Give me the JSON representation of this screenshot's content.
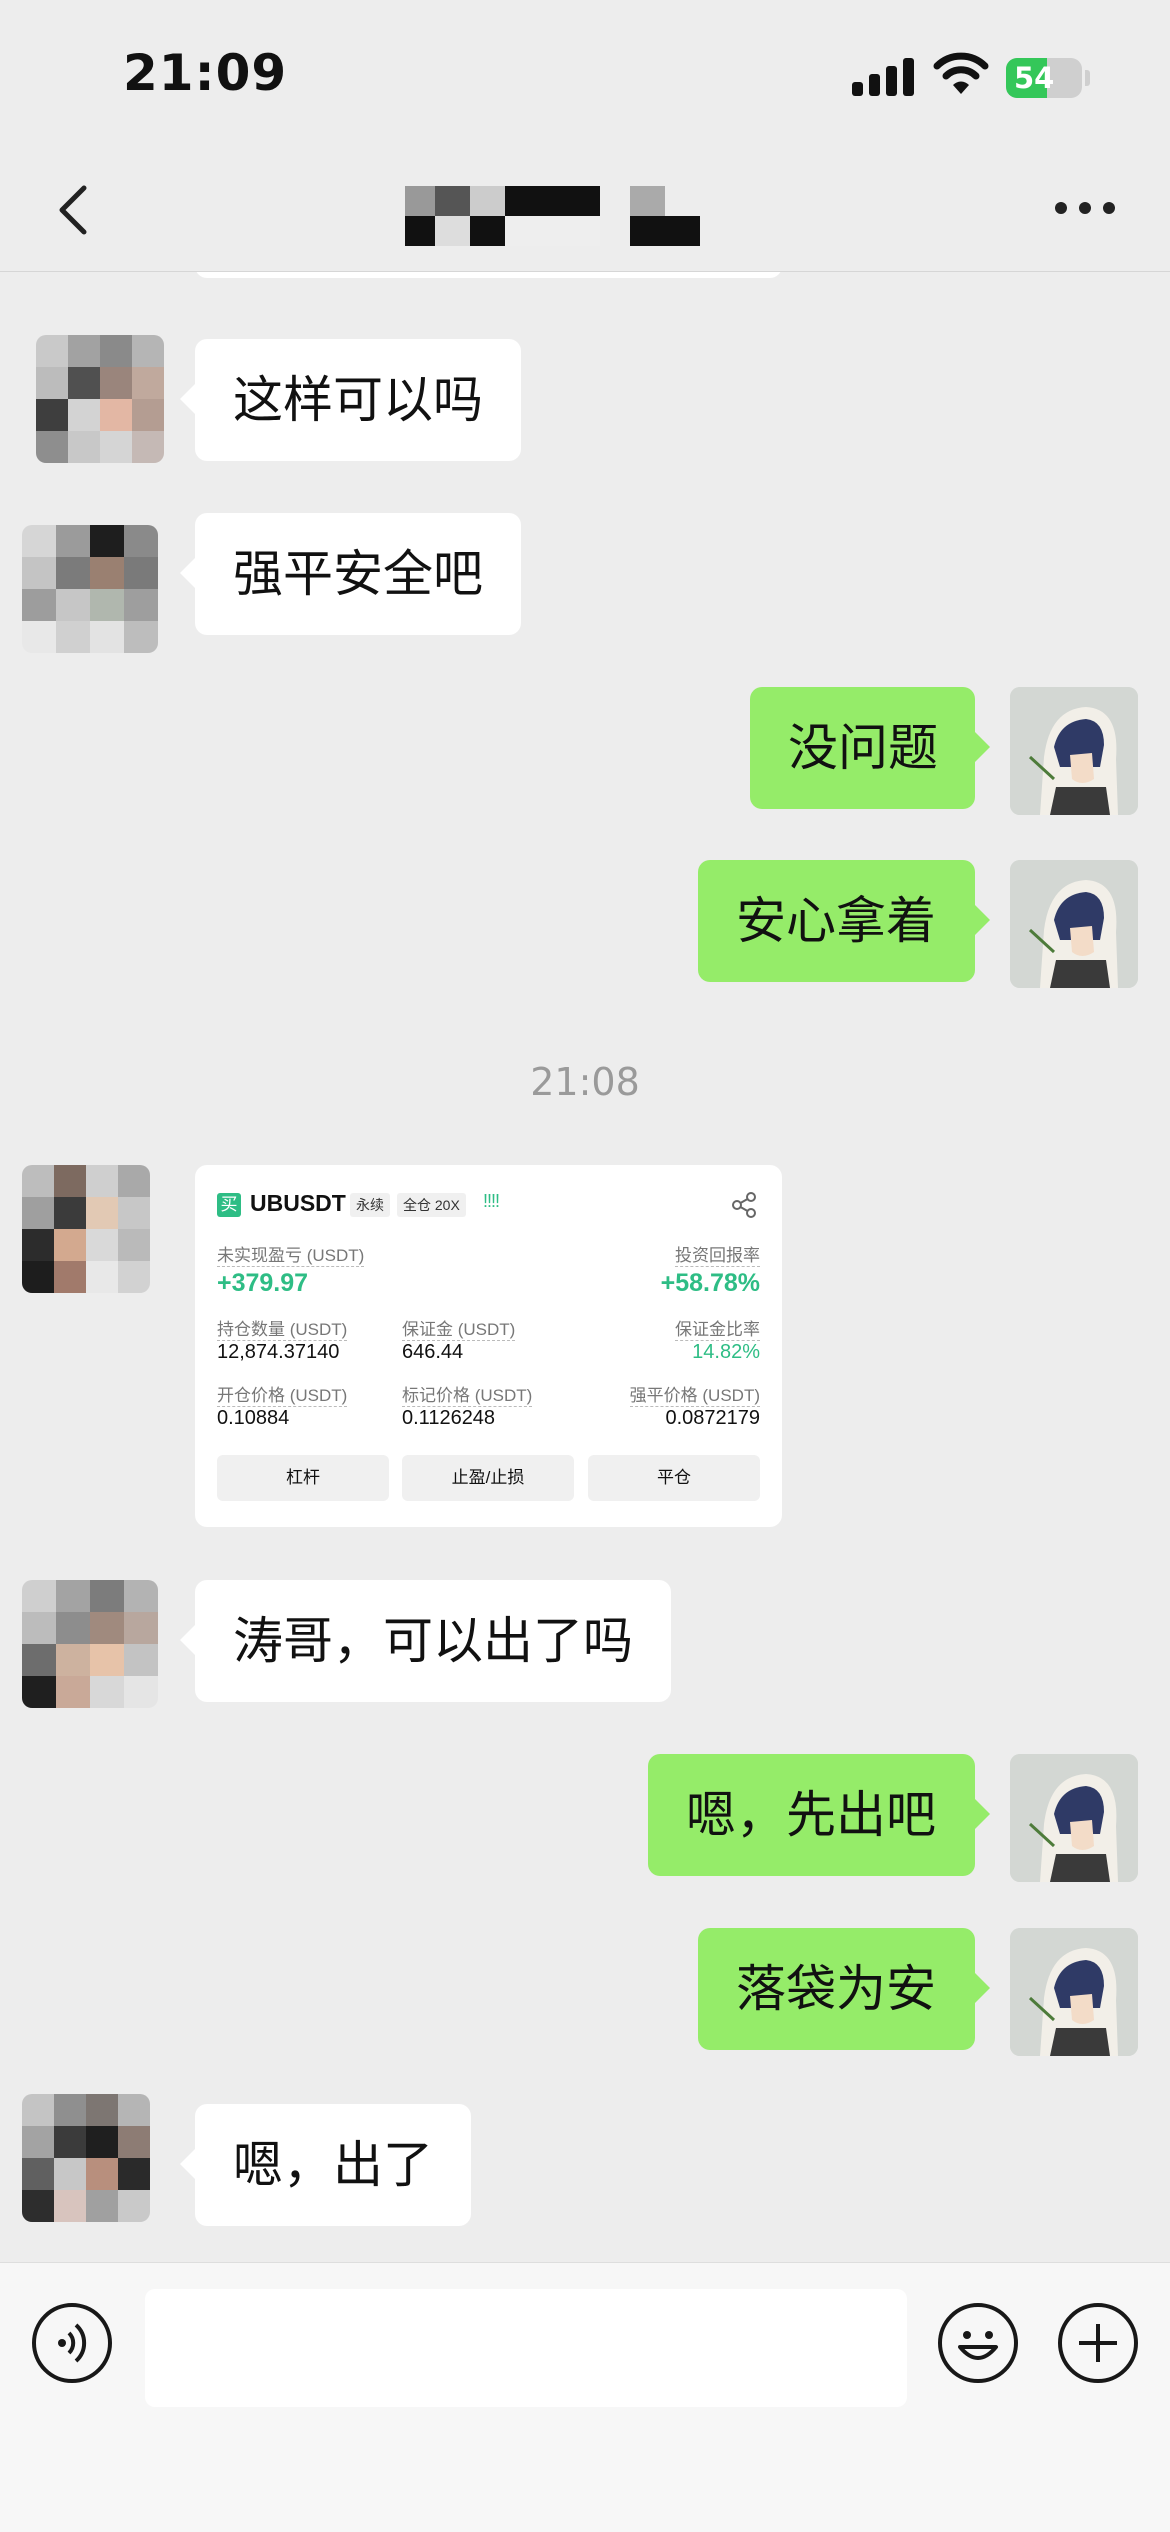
{
  "status_bar": {
    "time": "21:09",
    "battery": "54",
    "battery_level": 0.54
  },
  "header": {
    "title_redacted": true
  },
  "messages": [
    {
      "side": "in",
      "text": "这样可以吗"
    },
    {
      "side": "in",
      "text": "强平安全吧"
    },
    {
      "side": "out",
      "text": "没问题"
    },
    {
      "side": "out",
      "text": "安心拿着"
    },
    {
      "side": "in",
      "text": "涛哥，可以出了吗"
    },
    {
      "side": "out",
      "text": "嗯，先出吧"
    },
    {
      "side": "out",
      "text": "落袋为安"
    },
    {
      "side": "in",
      "text": "嗯，出了"
    }
  ],
  "timestamp": "21:08",
  "trade_card": {
    "side_badge": "买",
    "pair": "UBUSDT",
    "type_tag": "永续",
    "mode_tag": "全仓 20X",
    "signal_bars": "!!!!",
    "unrealized_pnl_label": "未实现盈亏 (USDT)",
    "unrealized_pnl": "+379.97",
    "roi_label": "投资回报率",
    "roi": "+58.78%",
    "position_label": "持仓数量 (USDT)",
    "position": "12,874.37140",
    "margin_label": "保证金 (USDT)",
    "margin": "646.44",
    "margin_ratio_label": "保证金比率",
    "margin_ratio": "14.82%",
    "entry_price_label": "开仓价格 (USDT)",
    "entry_price": "0.10884",
    "mark_price_label": "标记价格 (USDT)",
    "mark_price": "0.1126248",
    "liq_price_label": "强平价格 (USDT)",
    "liq_price": "0.0872179",
    "buttons": [
      "杠杆",
      "止盈/止损",
      "平仓"
    ]
  },
  "colors": {
    "outgoing_bubble": "#95ec69",
    "profit_green": "#2ebd85",
    "background": "#ededed"
  },
  "icons": [
    "back-icon",
    "more-icon",
    "voice-icon",
    "emoji-icon",
    "plus-icon",
    "share-icon"
  ]
}
